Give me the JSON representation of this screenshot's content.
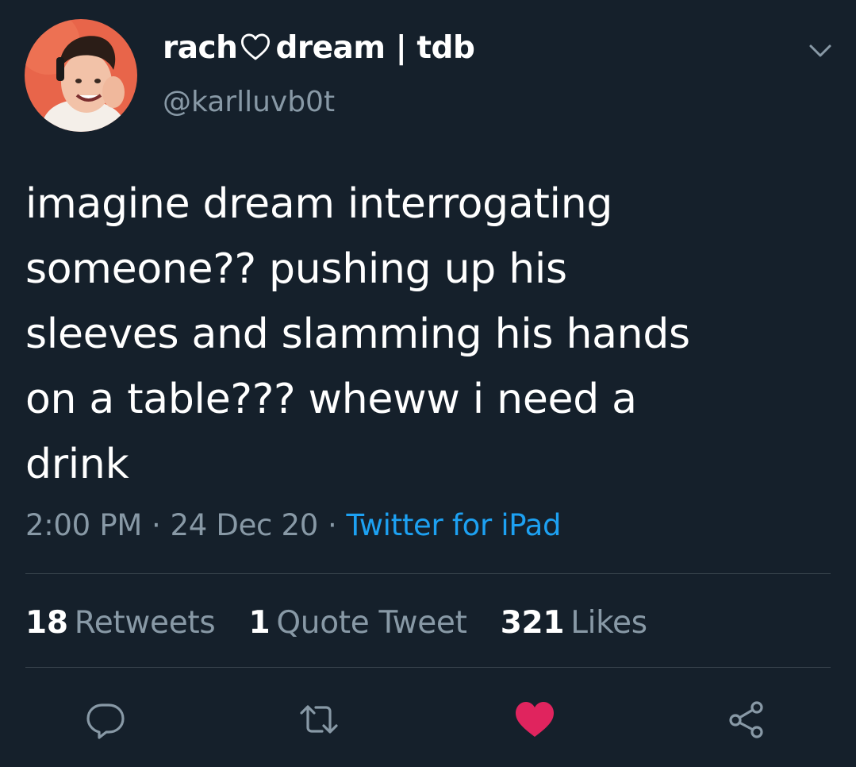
{
  "user": {
    "display_name_part1": "rach",
    "display_name_part2": "dream | tdb",
    "handle": "@karlluvb0t"
  },
  "tweet": {
    "text": "imagine dream interrogating\nsomeone?? pushing up his\nsleeves and slamming his hands\non a table??? wheww i need a\ndrink",
    "time": "2:00 PM",
    "date": "24 Dec 20",
    "source": "Twitter for iPad",
    "separator": "·"
  },
  "stats": {
    "retweets_count": "18",
    "retweets_label": "Retweets",
    "quotes_count": "1",
    "quotes_label": "Quote Tweet",
    "likes_count": "321",
    "likes_label": "Likes"
  },
  "colors": {
    "background": "#15202b",
    "secondary_text": "#8899a6",
    "link": "#1da1f2",
    "like": "#e0245e",
    "divider": "#38444d"
  },
  "icons": {
    "name_heart": "heart-outline-icon",
    "menu": "chevron-down-icon",
    "reply": "reply-icon",
    "retweet": "retweet-icon",
    "like": "heart-filled-icon",
    "share": "share-icon"
  }
}
